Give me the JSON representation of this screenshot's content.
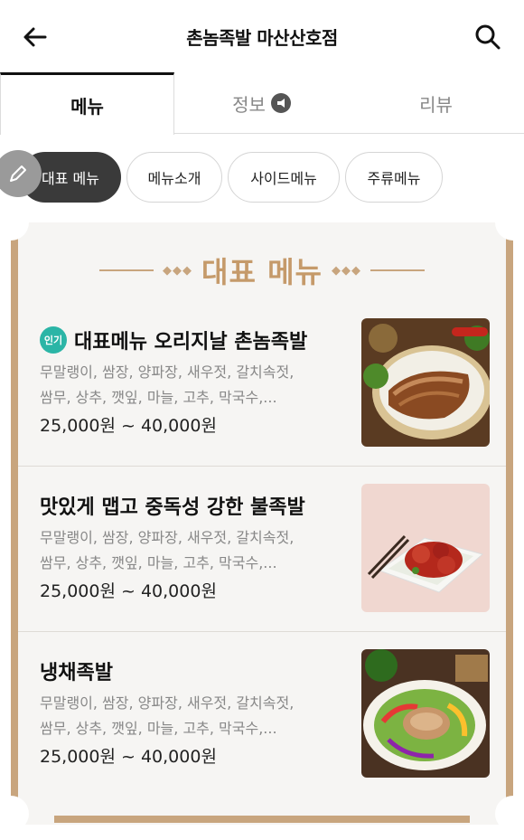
{
  "header": {
    "title": "촌놈족발 마산산호점",
    "back_icon": "arrow-left-icon",
    "search_icon": "search-icon"
  },
  "tabs": [
    {
      "label": "메뉴",
      "active": true
    },
    {
      "label": "정보",
      "active": false,
      "icon": "megaphone-icon"
    },
    {
      "label": "리뷰",
      "active": false
    }
  ],
  "chips": [
    {
      "label": "대표 메뉴",
      "active": true
    },
    {
      "label": "메뉴소개",
      "active": false
    },
    {
      "label": "사이드메뉴",
      "active": false
    },
    {
      "label": "주류메뉴",
      "active": false
    }
  ],
  "section": {
    "title": "대표 메뉴",
    "accent_color": "#c59a6a"
  },
  "menu_items": [
    {
      "badge": "인기",
      "name": "대표메뉴 오리지날 촌놈족발",
      "desc_line1": "무말랭이, 쌈장, 양파장, 새우젓, 갈치속젓,",
      "desc_line2": "쌈무, 상추, 깻잎, 마늘, 고추, 막국수,...",
      "price": "25,000원 ~ 40,000원",
      "image_icon": "jokbal-photo-icon"
    },
    {
      "badge": "",
      "name": "맛있게 맵고 중독성 강한 불족발",
      "desc_line1": "무말랭이, 쌈장, 양파장, 새우젓, 갈치속젓,",
      "desc_line2": "쌈무, 상추, 깻잎, 마늘, 고추, 막국수,...",
      "price": "25,000원 ~ 40,000원",
      "image_icon": "spicy-jokbal-photo-icon"
    },
    {
      "badge": "",
      "name": "냉채족발",
      "desc_line1": "무말랭이, 쌈장, 양파장, 새우젓, 갈치속젓,",
      "desc_line2": "쌈무, 상추, 깻잎, 마늘, 고추, 막국수,...",
      "price": "25,000원 ~ 40,000원",
      "image_icon": "cold-jokbal-photo-icon"
    }
  ]
}
